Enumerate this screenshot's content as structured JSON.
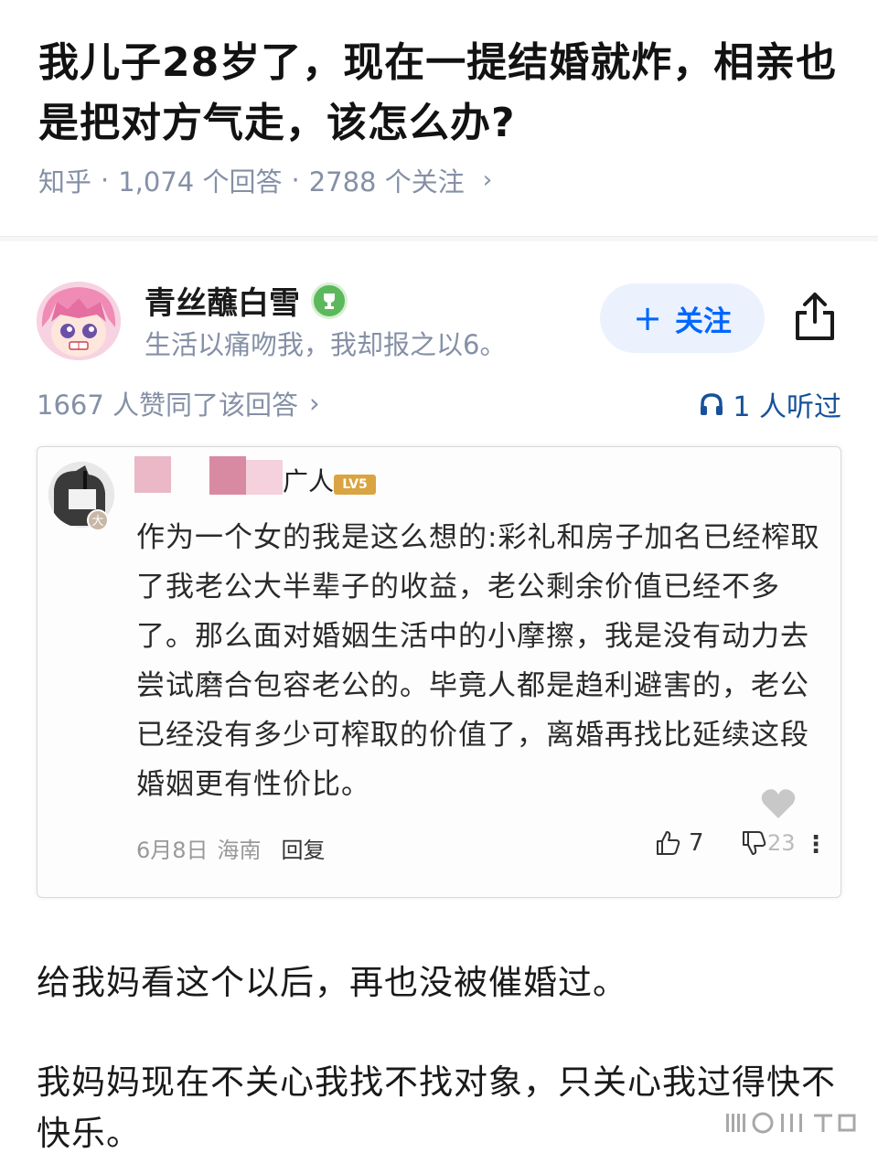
{
  "question": {
    "title": "我儿子28岁了，现在一提结婚就炸，相亲也是把对方气走，该怎么办?",
    "source": "知乎",
    "answers": "1,074 个回答",
    "followers": "2788 个关注"
  },
  "author": {
    "name": "青丝蘸白雪",
    "bio": "生活以痛吻我，我却报之以6。",
    "follow_label": "关注",
    "avatar_icon": "anime-pink-hair-avatar",
    "badge_icon": "trophy-badge-icon"
  },
  "answer_meta": {
    "likes_text": "1667 人赞同了该回答",
    "listened_text": "1 人听过"
  },
  "screenshot_comment": {
    "name_tail": "广人",
    "level": "LV5",
    "avatar_tag": "大",
    "body": "作为一个女的我是这么想的:彩礼和房子加名已经榨取了我老公大半辈子的收益，老公剩余价值已经不多了。那么面对婚姻生活中的小摩擦，我是没有动力去尝试磨合包容老公的。毕竟人都是趋利避害的，老公已经没有多少可榨取的价值了，离婚再找比延续这段婚姻更有性价比。",
    "date": "6月8日",
    "region": "海南",
    "reply_label": "回复",
    "like_count": "7",
    "dislike_count": "23"
  },
  "body": {
    "para1": "给我妈看这个以后，再也没被催婚过。",
    "para2": "我妈妈现在不关心我找不找对象，只关心我过得快不快乐。"
  },
  "colors": {
    "zhihu_blue": "#0066ff",
    "meta_gray": "#8590a6",
    "link_blue": "#175199"
  }
}
